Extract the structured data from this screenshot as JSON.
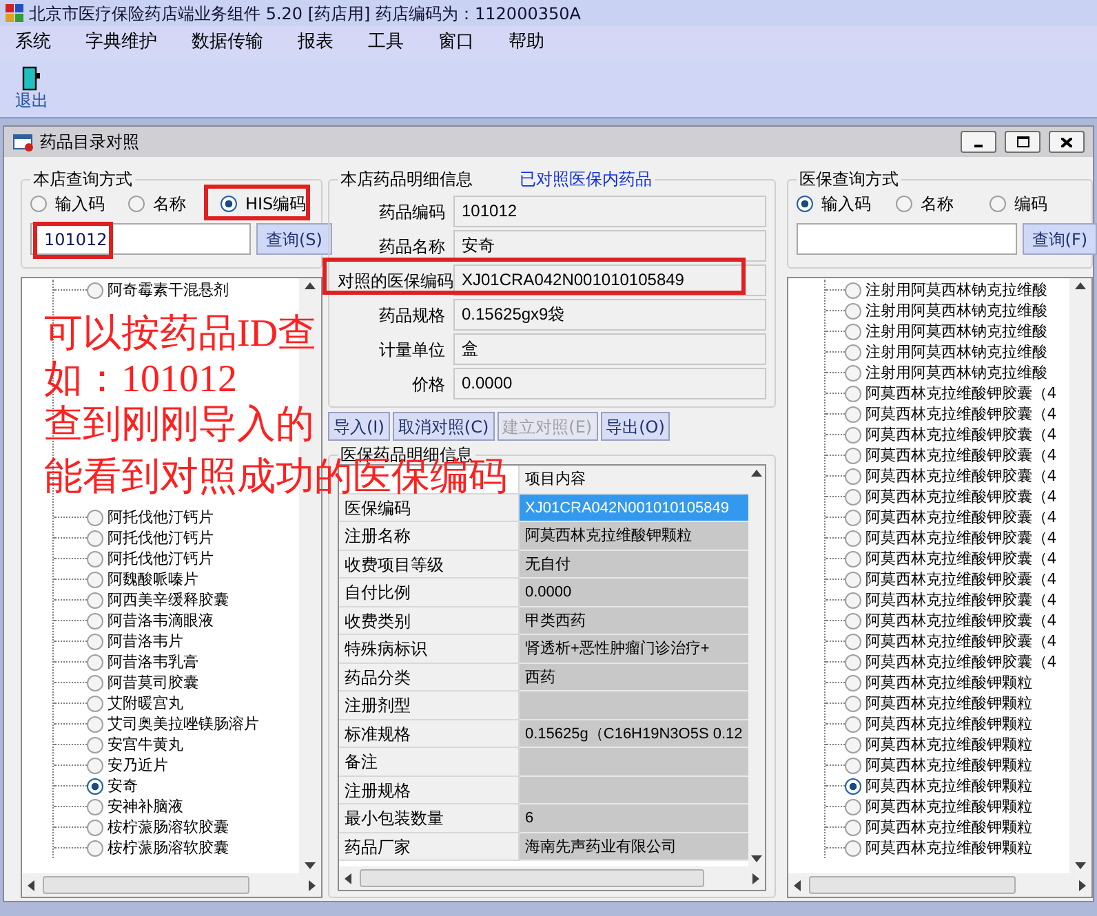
{
  "window": {
    "title": "北京市医疗保险药店端业务组件 5.20 [药店用] 药店编码为：112000350A"
  },
  "menu": [
    "系统",
    "字典维护",
    "数据传输",
    "报表",
    "工具",
    "窗口",
    "帮助"
  ],
  "toolbar": [
    {
      "label": "退出"
    }
  ],
  "child_window": {
    "title": "药品目录对照"
  },
  "local_search": {
    "title": "本店查询方式",
    "options": [
      {
        "label": "输入码",
        "selected": false
      },
      {
        "label": "名称",
        "selected": false
      },
      {
        "label": "HIS编码",
        "selected": true
      }
    ],
    "value": "101012",
    "button": "查询(S)"
  },
  "local_tree": [
    {
      "label": "阿奇霉素干混悬剂",
      "selected": false
    },
    {
      "kind": "covered"
    },
    {
      "kind": "covered"
    },
    {
      "kind": "covered"
    },
    {
      "kind": "covered"
    },
    {
      "kind": "covered"
    },
    {
      "kind": "covered"
    },
    {
      "kind": "covered"
    },
    {
      "kind": "covered"
    },
    {
      "kind": "covered"
    },
    {
      "kind": "covered"
    },
    {
      "label": "阿托伐他汀钙片",
      "selected": false
    },
    {
      "label": "阿托伐他汀钙片",
      "selected": false
    },
    {
      "label": "阿托伐他汀钙片",
      "selected": false
    },
    {
      "label": "阿魏酸哌嗪片",
      "selected": false
    },
    {
      "label": "阿西美辛缓释胶囊",
      "selected": false
    },
    {
      "label": "阿昔洛韦滴眼液",
      "selected": false
    },
    {
      "label": "阿昔洛韦片",
      "selected": false
    },
    {
      "label": "阿昔洛韦乳膏",
      "selected": false
    },
    {
      "label": "阿昔莫司胶囊",
      "selected": false
    },
    {
      "label": "艾附暖宫丸",
      "selected": false
    },
    {
      "label": "艾司奥美拉唑镁肠溶片",
      "selected": false
    },
    {
      "label": "安宫牛黄丸",
      "selected": false
    },
    {
      "label": "安乃近片",
      "selected": false
    },
    {
      "label": "安奇",
      "selected": true
    },
    {
      "label": "安神补脑液",
      "selected": false
    },
    {
      "label": "桉柠蒎肠溶软胶囊",
      "selected": false
    },
    {
      "label": "桉柠蒎肠溶软胶囊",
      "selected": false
    }
  ],
  "local_detail": {
    "title": "本店药品明细信息",
    "link": "已对照医保内药品",
    "fields": [
      {
        "label": "药品编码",
        "value": "101012"
      },
      {
        "label": "药品名称",
        "value": "安奇"
      },
      {
        "label": "对照的医保编码",
        "value": "XJ01CRA042N001010105849"
      },
      {
        "label": "药品规格",
        "value": "0.15625gx9袋"
      },
      {
        "label": "计量单位",
        "value": "盒"
      },
      {
        "label": "价格",
        "value": "0.0000"
      }
    ]
  },
  "actions": [
    {
      "label": "导入(I)",
      "disabled": false
    },
    {
      "label": "取消对照(C)",
      "disabled": false
    },
    {
      "label": "建立对照(E)",
      "disabled": true
    },
    {
      "label": "导出(O)",
      "disabled": false
    }
  ],
  "insurance_detail": {
    "title": "医保药品明细信息",
    "columns": [
      {
        "kind": "covered"
      },
      {
        "kind": "label",
        "label": "项目内容"
      }
    ],
    "rows": [
      {
        "item": "医保编码",
        "content": "XJ01CRA042N001010105849",
        "selected": true
      },
      {
        "item": "注册名称",
        "content": "阿莫西林克拉维酸钾颗粒",
        "selected": false
      },
      {
        "item": "收费项目等级",
        "content": "无自付",
        "selected": false
      },
      {
        "item": "自付比例",
        "content": "0.0000",
        "selected": false
      },
      {
        "item": "收费类别",
        "content": "甲类西药",
        "selected": false
      },
      {
        "item": "特殊病标识",
        "content": "肾透析+恶性肿瘤门诊治疗+",
        "selected": false
      },
      {
        "item": "药品分类",
        "content": "西药",
        "selected": false
      },
      {
        "item": "注册剂型",
        "selected": false
      },
      {
        "item": "标准规格",
        "content": "0.15625g（C16H19N3O5S 0.12",
        "selected": false
      },
      {
        "item": "备注",
        "selected": false
      },
      {
        "item": "注册规格",
        "selected": false
      },
      {
        "item": "最小包装数量",
        "content": "6",
        "selected": false
      },
      {
        "item": "药品厂家",
        "content": "海南先声药业有限公司",
        "selected": false
      }
    ]
  },
  "insurance_search": {
    "title": "医保查询方式",
    "options": [
      {
        "label": "输入码",
        "selected": true
      },
      {
        "label": "名称",
        "selected": false
      },
      {
        "label": "编码",
        "selected": false
      }
    ],
    "button": "查询(F)"
  },
  "insurance_tree": [
    {
      "label": "注射用阿莫西林钠克拉维酸",
      "selected": false
    },
    {
      "label": "注射用阿莫西林钠克拉维酸",
      "selected": false
    },
    {
      "label": "注射用阿莫西林钠克拉维酸",
      "selected": false
    },
    {
      "label": "注射用阿莫西林钠克拉维酸",
      "selected": false
    },
    {
      "label": "注射用阿莫西林钠克拉维酸",
      "selected": false
    },
    {
      "label": "阿莫西林克拉维酸钾胶囊（4",
      "selected": false
    },
    {
      "label": "阿莫西林克拉维酸钾胶囊（4",
      "selected": false
    },
    {
      "label": "阿莫西林克拉维酸钾胶囊（4",
      "selected": false
    },
    {
      "label": "阿莫西林克拉维酸钾胶囊（4",
      "selected": false
    },
    {
      "label": "阿莫西林克拉维酸钾胶囊（4",
      "selected": false
    },
    {
      "label": "阿莫西林克拉维酸钾胶囊（4",
      "selected": false
    },
    {
      "label": "阿莫西林克拉维酸钾胶囊（4",
      "selected": false
    },
    {
      "label": "阿莫西林克拉维酸钾胶囊（4",
      "selected": false
    },
    {
      "label": "阿莫西林克拉维酸钾胶囊（4",
      "selected": false
    },
    {
      "label": "阿莫西林克拉维酸钾胶囊（4",
      "selected": false
    },
    {
      "label": "阿莫西林克拉维酸钾胶囊（4",
      "selected": false
    },
    {
      "label": "阿莫西林克拉维酸钾胶囊（4",
      "selected": false
    },
    {
      "label": "阿莫西林克拉维酸钾胶囊（4",
      "selected": false
    },
    {
      "label": "阿莫西林克拉维酸钾胶囊（4",
      "selected": false
    },
    {
      "label": "阿莫西林克拉维酸钾颗粒",
      "selected": false
    },
    {
      "label": "阿莫西林克拉维酸钾颗粒",
      "selected": false
    },
    {
      "label": "阿莫西林克拉维酸钾颗粒",
      "selected": false
    },
    {
      "label": "阿莫西林克拉维酸钾颗粒",
      "selected": false
    },
    {
      "label": "阿莫西林克拉维酸钾颗粒",
      "selected": false
    },
    {
      "label": "阿莫西林克拉维酸钾颗粒",
      "selected": true
    },
    {
      "label": "阿莫西林克拉维酸钾颗粒",
      "selected": false
    },
    {
      "label": "阿莫西林克拉维酸钾颗粒",
      "selected": false
    },
    {
      "label": "阿莫西林克拉维酸钾颗粒",
      "selected": false
    }
  ],
  "annotation": {
    "lines": [
      "可以按药品ID查",
      "如：101012",
      "查到刚刚导入的",
      "能看到对照成功的医保编码"
    ]
  }
}
